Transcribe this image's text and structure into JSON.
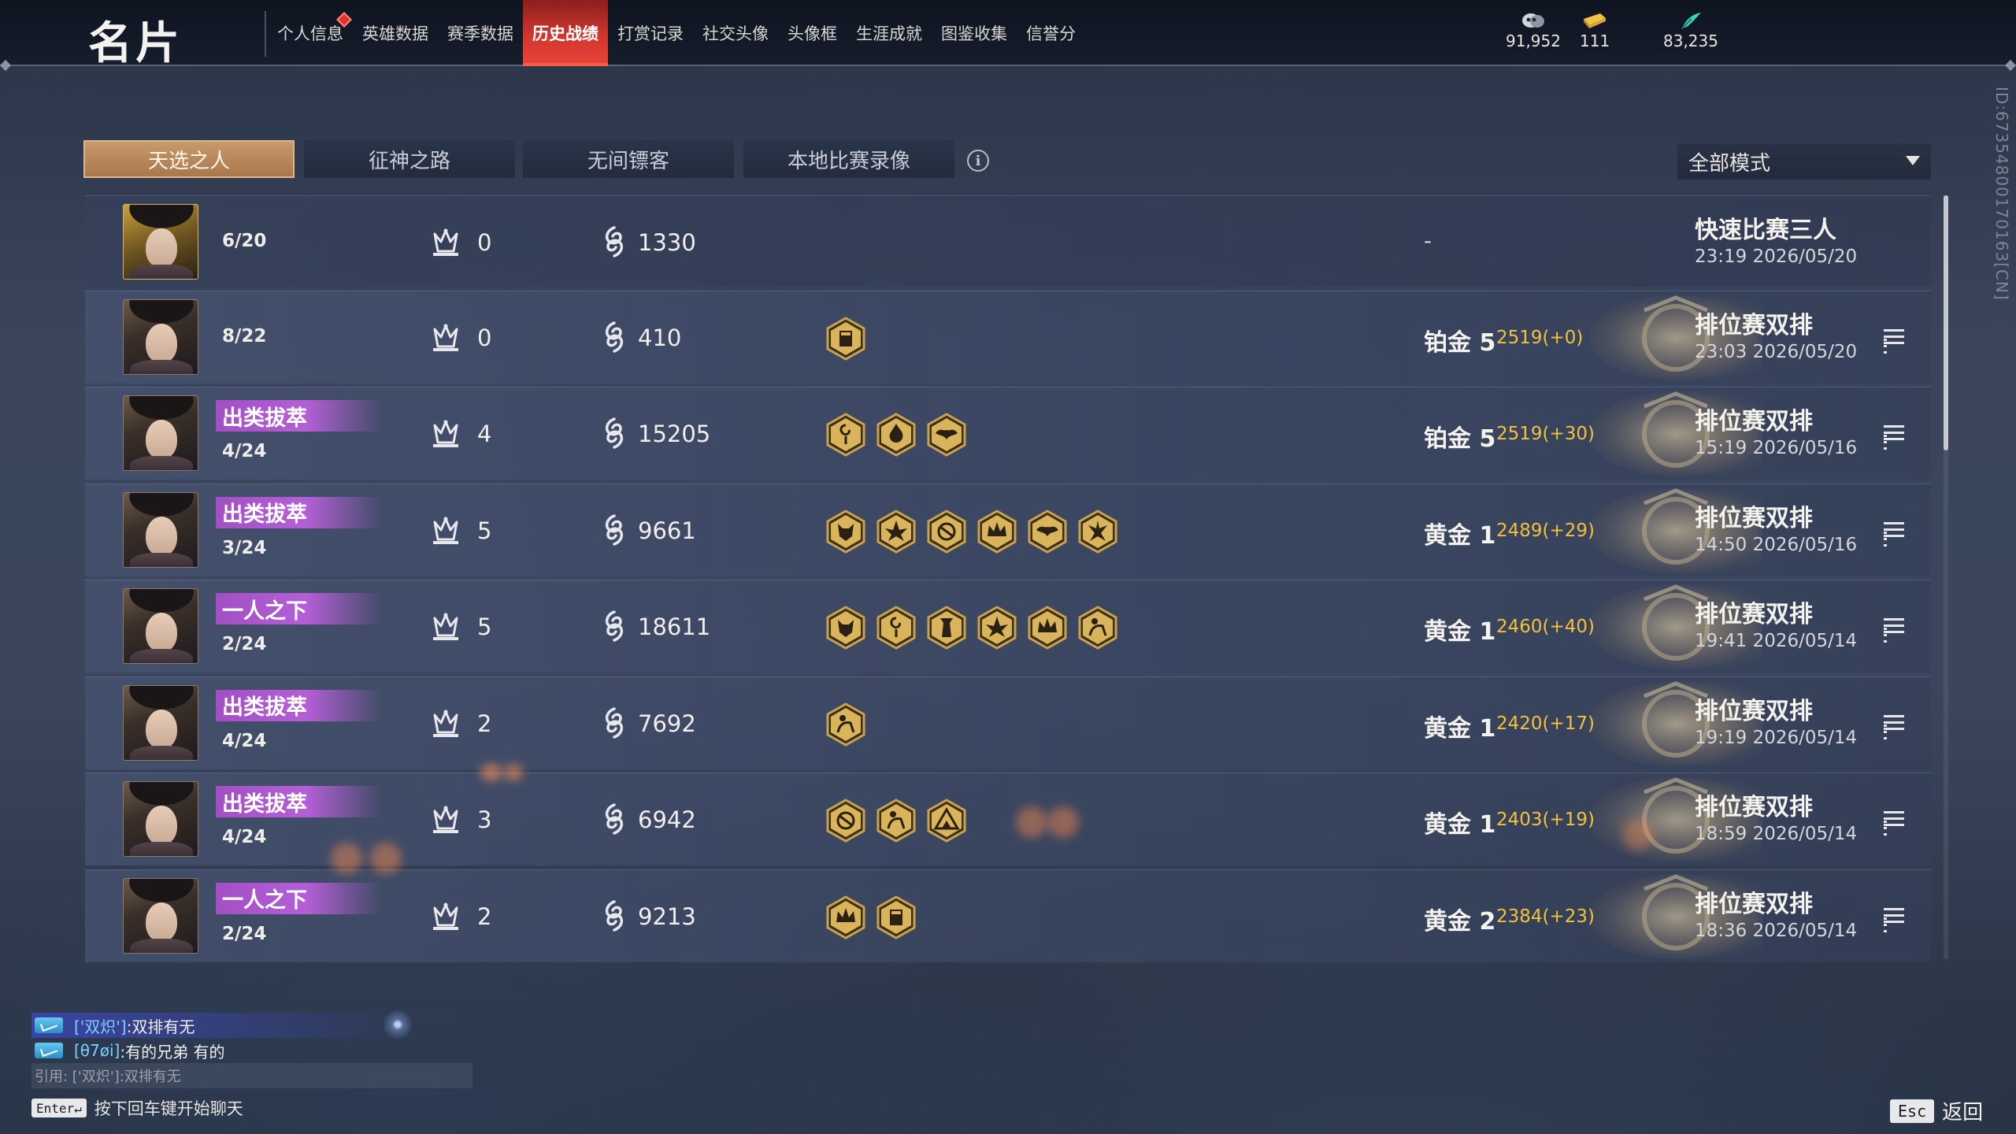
{
  "page_title": "名片",
  "nav": [
    {
      "label": "个人信息",
      "active": false,
      "dot": true
    },
    {
      "label": "英雄数据",
      "active": false
    },
    {
      "label": "赛季数据",
      "active": false
    },
    {
      "label": "历史战绩",
      "active": true
    },
    {
      "label": "打赏记录",
      "active": false
    },
    {
      "label": "社交头像",
      "active": false
    },
    {
      "label": "头像框",
      "active": false
    },
    {
      "label": "生涯成就",
      "active": false
    },
    {
      "label": "图鉴收集",
      "active": false
    },
    {
      "label": "信誉分",
      "active": false
    }
  ],
  "currencies": [
    {
      "icon": "mask-coin-icon",
      "value": "91,952"
    },
    {
      "icon": "gold-ticket-icon",
      "value": "111"
    },
    {
      "icon": "jade-feather-icon",
      "value": "83,235"
    }
  ],
  "tabs": [
    {
      "label": "天选之人",
      "active": true
    },
    {
      "label": "征神之路",
      "active": false
    },
    {
      "label": "无间镖客",
      "active": false
    },
    {
      "label": "本地比赛录像",
      "active": false
    }
  ],
  "info_icon": "i",
  "mode_select": {
    "value": "全部模式"
  },
  "user_id": "ID:6735480017016​3[CN]",
  "matches": [
    {
      "title": "",
      "placement": "6/20",
      "kills": "0",
      "damage": "1330",
      "badges": [],
      "rank": "",
      "rank_score": "",
      "dash": "-",
      "mode": "快速比赛三人",
      "time": "23:19  2026/05/20",
      "detail": false,
      "portrait": "gold"
    },
    {
      "title": "",
      "placement": "8/22",
      "kills": "0",
      "damage": "410",
      "badges": [
        "shield"
      ],
      "rank": "铂金 5",
      "rank_score": "2519(+0)",
      "dash": "",
      "mode": "排位赛双排",
      "time": "23:03  2026/05/20",
      "detail": true,
      "portrait": "dark"
    },
    {
      "title": "出类拔萃",
      "placement": "4/24",
      "kills": "4",
      "damage": "15205",
      "badges": [
        "spiral",
        "flame",
        "wings"
      ],
      "rank": "铂金 5",
      "rank_score": "2519(+30)",
      "dash": "",
      "mode": "排位赛双排",
      "time": "15:19  2026/05/16",
      "detail": true,
      "portrait": "dark"
    },
    {
      "title": "出类拔萃",
      "placement": "3/24",
      "kills": "5",
      "damage": "9661",
      "badges": [
        "beast",
        "lotus",
        "swirl",
        "crown",
        "wings",
        "phoenix"
      ],
      "rank": "黄金 1",
      "rank_score": "2489(+29)",
      "dash": "",
      "mode": "排位赛双排",
      "time": "14:50  2026/05/16",
      "detail": true,
      "portrait": "light"
    },
    {
      "title": "一人之下",
      "placement": "2/24",
      "kills": "5",
      "damage": "18611",
      "badges": [
        "beast",
        "spiral",
        "tower",
        "lotus",
        "crown",
        "rider"
      ],
      "rank": "黄金 1",
      "rank_score": "2460(+40)",
      "dash": "",
      "mode": "排位赛双排",
      "time": "19:41  2026/05/14",
      "detail": true,
      "portrait": "ornate"
    },
    {
      "title": "出类拔萃",
      "placement": "4/24",
      "kills": "2",
      "damage": "7692",
      "badges": [
        "rider"
      ],
      "rank": "黄金 1",
      "rank_score": "2420(+17)",
      "dash": "",
      "mode": "排位赛双排",
      "time": "19:19  2026/05/14",
      "detail": true,
      "portrait": "dark"
    },
    {
      "title": "出类拔萃",
      "placement": "4/24",
      "kills": "3",
      "damage": "6942",
      "badges": [
        "swirl",
        "rider",
        "mountain"
      ],
      "rank": "黄金 1",
      "rank_score": "2403(+19)",
      "dash": "",
      "mode": "排位赛双排",
      "time": "18:59  2026/05/14",
      "detail": true,
      "portrait": "dark"
    },
    {
      "title": "一人之下",
      "placement": "2/24",
      "kills": "2",
      "damage": "9213",
      "badges": [
        "crown",
        "shield"
      ],
      "rank": "黄金 2",
      "rank_score": "2384(+23)",
      "dash": "",
      "mode": "排位赛双排",
      "time": "18:36  2026/05/14",
      "detail": true,
      "portrait": "light"
    }
  ],
  "chat": {
    "messages": [
      {
        "name": "['双炽']",
        "text": ":双排有无",
        "highlight": true
      },
      {
        "name": "[θ7øi]",
        "text": ":有的兄弟  有的",
        "highlight": false
      }
    ],
    "quote": "引用: ['双炽']:双排有无",
    "enter_key": "Enter↵",
    "enter_hint": "按下回车键开始聊天"
  },
  "back": {
    "key": "Esc",
    "label": "返回"
  },
  "colors": {
    "accent_red": "#d2362e",
    "tab_active": "#a9774c",
    "title_purple": "#a24fc4",
    "score_gold": "#f2c23a",
    "chat_name": "#7ad1ff"
  }
}
